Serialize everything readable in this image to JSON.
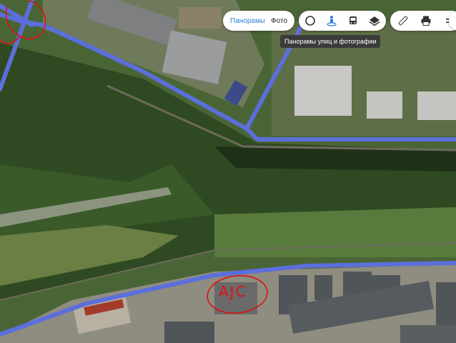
{
  "toolbar": {
    "tabs": [
      {
        "label": "Панорамы",
        "active": true
      },
      {
        "label": "Фото",
        "active": false
      }
    ],
    "icons": [
      "layers-circle-icon",
      "panorama-man-icon",
      "transit-bus-icon",
      "map-layers-icon",
      "ruler-icon",
      "print-icon",
      "menu-icon"
    ],
    "tooltip": "Панорамы улиц и фотографии"
  },
  "annotation": {
    "text": "AJC",
    "color": "#e01010"
  },
  "colors": {
    "panorama_road": "#5b6fdc",
    "active_tab": "#2f7fd6",
    "tooltip_bg": "#3b3b3b",
    "annotation": "#e01010"
  }
}
